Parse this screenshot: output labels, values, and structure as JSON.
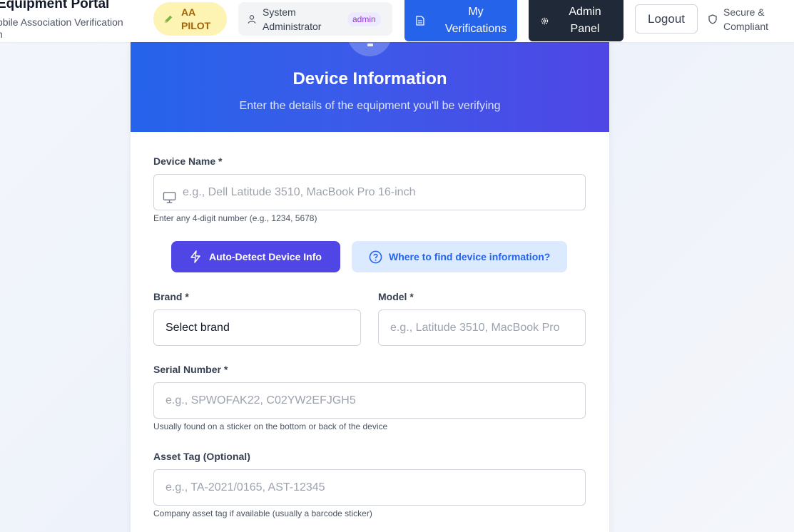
{
  "header": {
    "brand_title": "Equipment Portal",
    "brand_subtitle": "obile Association Verification",
    "brand_subtitle_cont": "n",
    "pilot_badge": "AA\nPILOT",
    "user_name": "System\nAdministrator",
    "user_role": "admin",
    "my_verifications_label": "My\nVerifications",
    "admin_panel_label": "Admin\nPanel",
    "logout_label": "Logout",
    "secure_label": "Secure &\nCompliant"
  },
  "card": {
    "title": "Device Information",
    "subtitle": "Enter the details of the equipment you'll be verifying"
  },
  "form": {
    "device_name": {
      "label": "Device Name *",
      "placeholder": "e.g., Dell Latitude 3510, MacBook Pro 16-inch",
      "value": "",
      "hint": "Enter any 4-digit number (e.g., 1234, 5678)"
    },
    "auto_detect_label": "Auto-Detect Device Info",
    "where_to_find_label": "Where to find device information?",
    "brand": {
      "label": "Brand *",
      "selected": "Select brand"
    },
    "model": {
      "label": "Model *",
      "placeholder": "e.g., Latitude 3510, MacBook Pro",
      "value": ""
    },
    "serial": {
      "label": "Serial Number *",
      "placeholder": "e.g., SPWOFAK22, C02YW2EFJGH5",
      "value": "",
      "hint": "Usually found on a sticker on the bottom or back of the device"
    },
    "asset_tag": {
      "label": "Asset Tag (Optional)",
      "placeholder": "e.g., TA-2021/0165, AST-12345",
      "value": "",
      "hint": "Company asset tag if available (usually a barcode sticker)"
    }
  },
  "icons": {
    "pencil": "pencil-icon",
    "user": "user-icon",
    "document": "document-icon",
    "gear": "gear-icon",
    "shield": "shield-icon",
    "monitor": "monitor-icon",
    "bolt": "lightning-bolt-icon",
    "help": "question-circle-icon"
  },
  "colors": {
    "primary_blue": "#2563eb",
    "indigo": "#4f46e5",
    "dark": "#1f2937",
    "pilot_bg": "#fdf3b3",
    "role_text": "#9333ea"
  }
}
